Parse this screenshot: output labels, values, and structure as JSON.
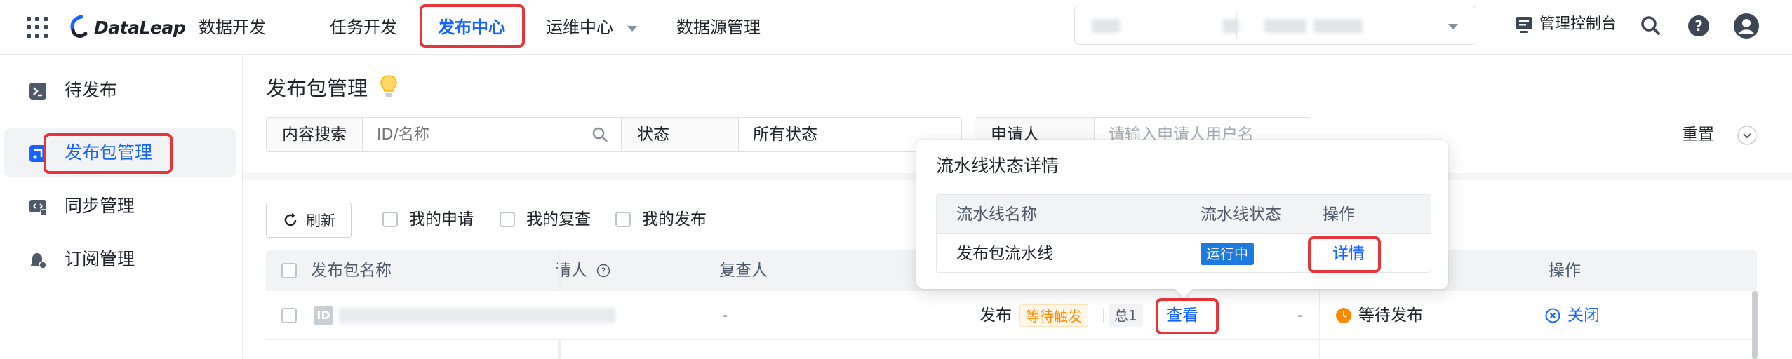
{
  "header": {
    "logo_text": "DataLeap",
    "logo_sub": "数据开发",
    "nav": [
      {
        "label": "任务开发"
      },
      {
        "label": "发布中心"
      },
      {
        "label": "运维中心"
      },
      {
        "label": "数据源管理"
      }
    ],
    "console_label": "管理控制台"
  },
  "sidebar": {
    "items": [
      {
        "label": "待发布"
      },
      {
        "label": "发布包管理"
      },
      {
        "label": "同步管理"
      },
      {
        "label": "订阅管理"
      }
    ]
  },
  "page": {
    "title": "发布包管理",
    "filters": {
      "search_label": "内容搜索",
      "search_placeholder": "ID/名称",
      "status_label": "状态",
      "status_value": "所有状态",
      "applicant_label": "申请人",
      "applicant_placeholder": "请输入申请人用户名"
    },
    "reset_label": "重置",
    "refresh_label": "刷新",
    "checkboxes": [
      "我的申请",
      "我的复查",
      "我的发布"
    ],
    "table": {
      "columns": [
        "发布包名称",
        "请人",
        "复查人",
        "操作"
      ],
      "row": {
        "reviewer": "-",
        "publish_label": "发布",
        "wait_trigger_tag": "等待触发",
        "total_label": "总1",
        "view_link": "查看",
        "dash": "-",
        "status": "等待发布",
        "action": "关闭",
        "id_badge": "ID"
      }
    }
  },
  "popover": {
    "title": "流水线状态详情",
    "columns": [
      "流水线名称",
      "流水线状态",
      "操作"
    ],
    "rows": [
      {
        "name": "发布包流水线",
        "status": "运行中",
        "action": "详情"
      }
    ]
  },
  "colors": {
    "accent": "#1664ff",
    "highlight_red": "#e5373b",
    "warning_orange": "#ff8a00",
    "running_blue": "#1f7ae0"
  }
}
